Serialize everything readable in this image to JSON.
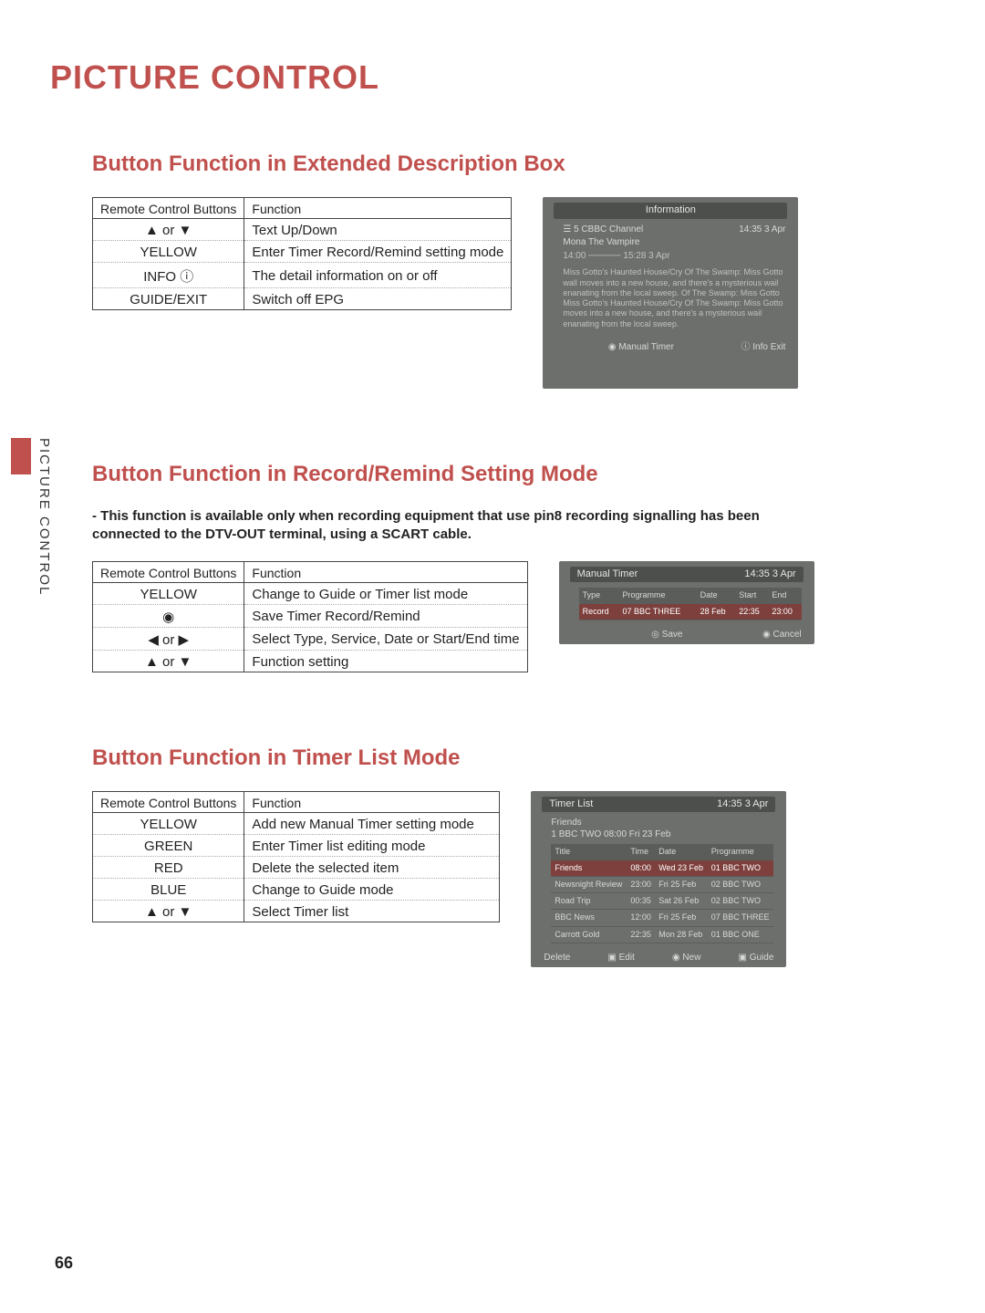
{
  "title": "PICTURE CONTROL",
  "sidebar_label": "PICTURE CONTROL",
  "page_number": "66",
  "headers": {
    "buttons": "Remote Control Buttons",
    "function": "Function"
  },
  "section1": {
    "heading": "Button Function in Extended Description Box",
    "rows": [
      {
        "btn": "▲ or ▼",
        "fn": "Text Up/Down"
      },
      {
        "btn": "YELLOW",
        "fn": "Enter Timer Record/Remind setting mode"
      },
      {
        "btn": "INFO ⓘ",
        "fn": "The detail information on or off"
      },
      {
        "btn": "GUIDE/EXIT",
        "fn": "Switch off EPG"
      }
    ],
    "shot": {
      "title": "Information",
      "clock": "14:35  3 Apr",
      "channel": "☰ 5 CBBC Channel",
      "programme": "Mona The Vampire",
      "timebar": "14:00 ───── 15:28  3 Apr",
      "desc": "Miss Gotto's Haunted House/Cry Of The Swamp: Miss Gotto wall moves into a new house, and there's a mysterious wail enanating from the local sweep. Of The Swamp: Miss Gotto Miss Gotto's Haunted House/Cry Of The Swamp: Miss Gotto moves into a new house, and there's a mysterious wail enanating from the local sweep.",
      "foot_right": "ⓘ  Info Exit",
      "foot_center": "◉ Manual Timer"
    }
  },
  "section2": {
    "heading": "Button Function in Record/Remind Setting Mode",
    "note": "- This function is available only when recording equipment that use pin8 recording signalling has been connected to the DTV-OUT terminal, using a SCART cable.",
    "rows": [
      {
        "btn": "YELLOW",
        "fn": "Change to Guide or Timer list mode"
      },
      {
        "btn": "◉",
        "fn": "Save Timer Record/Remind"
      },
      {
        "btn": "◀ or ▶",
        "fn": "Select Type, Service, Date or Start/End time"
      },
      {
        "btn": "▲ or ▼",
        "fn": "Function setting"
      }
    ],
    "shot": {
      "title": "Manual Timer",
      "clock": "14:35  3 Apr",
      "cols": [
        "Type",
        "Programme",
        "Date",
        "Start",
        "End"
      ],
      "row": [
        "Record",
        "07 BBC THREE",
        "28 Feb",
        "22:35",
        "23:00"
      ],
      "foot_save": "◎ Save",
      "foot_cancel": "◉ Cancel"
    }
  },
  "section3": {
    "heading": "Button Function in Timer List Mode",
    "rows": [
      {
        "btn": "YELLOW",
        "fn": "Add new Manual Timer setting mode"
      },
      {
        "btn": "GREEN",
        "fn": "Enter Timer list editing mode"
      },
      {
        "btn": "RED",
        "fn": "Delete the selected item"
      },
      {
        "btn": "BLUE",
        "fn": "Change to Guide mode"
      },
      {
        "btn": "▲ or ▼",
        "fn": "Select Timer list"
      }
    ],
    "shot": {
      "title": "Timer List",
      "clock": "14:35  3 Apr",
      "sub1": "Friends",
      "sub2": "1  BBC TWO     08:00   Fri 23 Feb",
      "cols": [
        "Title",
        "Time",
        "Date",
        "Programme"
      ],
      "rows": [
        [
          "Friends",
          "08:00",
          "Wed 23 Feb",
          "01 BBC TWO"
        ],
        [
          "Newsnight Review",
          "23:00",
          "Fri  25 Feb",
          "02 BBC TWO"
        ],
        [
          "Road Trip",
          "00:35",
          "Sat 26 Feb",
          "02 BBC TWO"
        ],
        [
          "BBC News",
          "12:00",
          "Fri  25 Feb",
          "07 BBC THREE"
        ],
        [
          "Carrott Gold",
          "22:35",
          "Mon 28 Feb",
          "01 BBC ONE"
        ]
      ],
      "foot": [
        "Delete",
        "▣ Edit",
        "◉ New",
        "▣ Guide"
      ]
    }
  }
}
